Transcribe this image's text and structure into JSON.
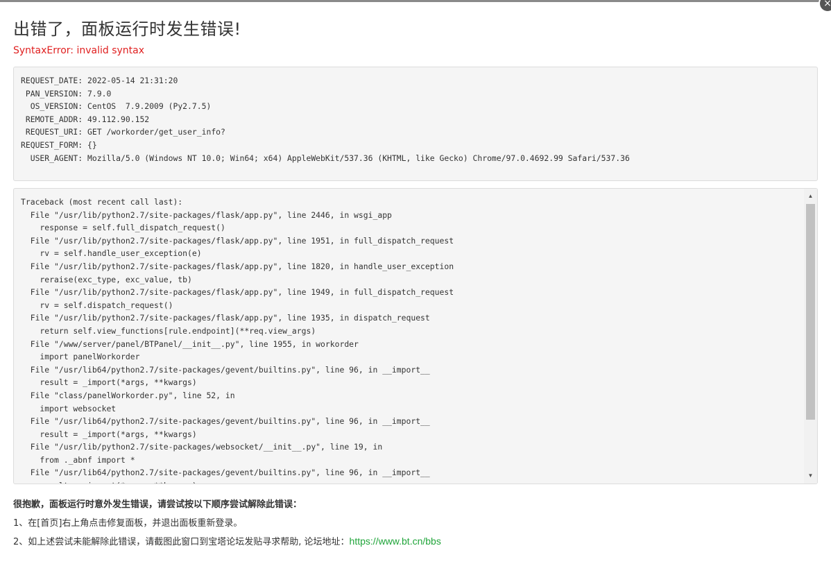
{
  "page": {
    "title": "出错了，面板运行时发生错误!",
    "error_message": "SyntaxError: invalid syntax",
    "close_symbol": "×"
  },
  "request_info": [
    {
      "key": "REQUEST_DATE",
      "value": "2022-05-14 21:31:20"
    },
    {
      "key": "PAN_VERSION",
      "value": "7.9.0"
    },
    {
      "key": "OS_VERSION",
      "value": "CentOS  7.9.2009 (Py2.7.5)"
    },
    {
      "key": "REMOTE_ADDR",
      "value": "49.112.90.152"
    },
    {
      "key": "REQUEST_URI",
      "value": "GET /workorder/get_user_info?"
    },
    {
      "key": "REQUEST_FORM",
      "value": "{}"
    },
    {
      "key": "USER_AGENT",
      "value": "Mozilla/5.0 (Windows NT 10.0; Win64; x64) AppleWebKit/537.36 (KHTML, like Gecko) Chrome/97.0.4692.99 Safari/537.36"
    }
  ],
  "traceback": [
    "Traceback (most recent call last):",
    "  File \"/usr/lib/python2.7/site-packages/flask/app.py\", line 2446, in wsgi_app",
    "    response = self.full_dispatch_request()",
    "  File \"/usr/lib/python2.7/site-packages/flask/app.py\", line 1951, in full_dispatch_request",
    "    rv = self.handle_user_exception(e)",
    "  File \"/usr/lib/python2.7/site-packages/flask/app.py\", line 1820, in handle_user_exception",
    "    reraise(exc_type, exc_value, tb)",
    "  File \"/usr/lib/python2.7/site-packages/flask/app.py\", line 1949, in full_dispatch_request",
    "    rv = self.dispatch_request()",
    "  File \"/usr/lib/python2.7/site-packages/flask/app.py\", line 1935, in dispatch_request",
    "    return self.view_functions[rule.endpoint](**req.view_args)",
    "  File \"/www/server/panel/BTPanel/__init__.py\", line 1955, in workorder",
    "    import panelWorkorder",
    "  File \"/usr/lib64/python2.7/site-packages/gevent/builtins.py\", line 96, in __import__",
    "    result = _import(*args, **kwargs)",
    "  File \"class/panelWorkorder.py\", line 52, in",
    "    import websocket",
    "  File \"/usr/lib64/python2.7/site-packages/gevent/builtins.py\", line 96, in __import__",
    "    result = _import(*args, **kwargs)",
    "  File \"/usr/lib/python2.7/site-packages/websocket/__init__.py\", line 19, in",
    "    from ._abnf import *",
    "  File \"/usr/lib64/python2.7/site-packages/gevent/builtins.py\", line 96, in __import__",
    "    result = _import(*args, **kwargs)"
  ],
  "help": {
    "heading": "很抱歉，面板运行时意外发生错误，请尝试按以下顺序尝试解除此错误：",
    "step1": "1、在[首页]右上角点击修复面板，并退出面板重新登录。",
    "step2": "2、如上述尝试未能解除此错误，请截图此窗口到宝塔论坛发贴寻求帮助, 论坛地址：",
    "forum_link": "https://www.bt.cn/bbs"
  },
  "icons": {
    "close": "close-icon",
    "scroll_up": "scroll-up-arrow-icon",
    "scroll_down": "scroll-down-arrow-icon"
  },
  "colors": {
    "error": "#e02020",
    "link": "#20a53a",
    "box_bg": "#f5f5f5"
  }
}
